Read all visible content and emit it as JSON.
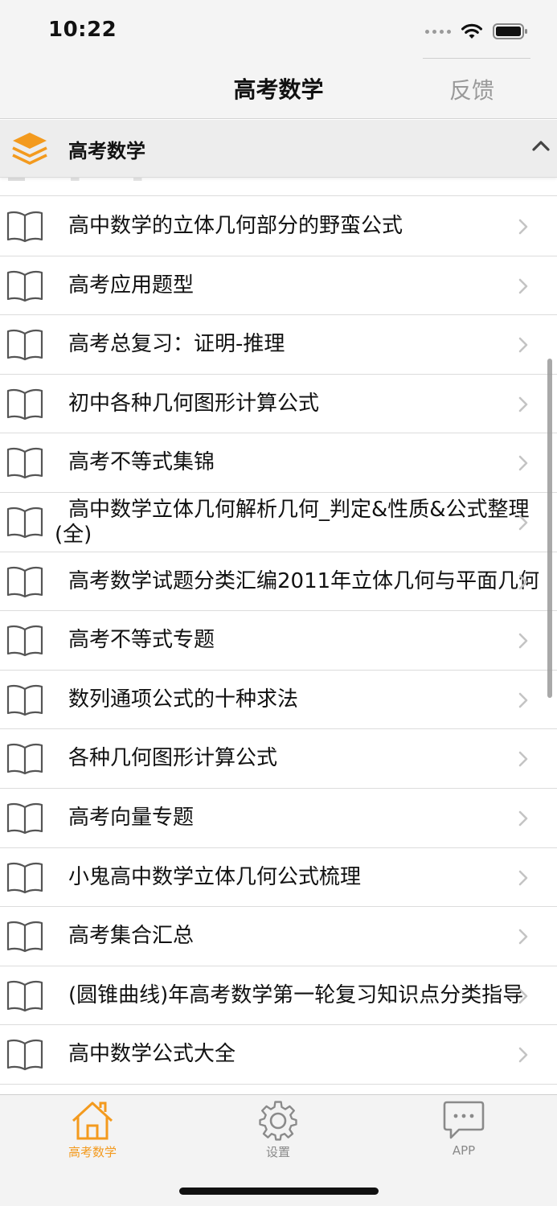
{
  "status_bar": {
    "time": "10:22"
  },
  "nav": {
    "title": "高考数学",
    "right_button": "反馈"
  },
  "section": {
    "title": "高考数学"
  },
  "list": {
    "items": [
      "高中数学的立体几何部分的野蛮公式",
      "高考应用题型",
      "高考总复习：证明-推理",
      "初中各种几何图形计算公式",
      "高考不等式集锦",
      "高中数学立体几何解析几何_判定&性质&公式整理(全)",
      "高考数学试题分类汇编2011年立体几何与平面几何",
      "高考不等式专题",
      "数列通项公式的十种求法",
      "各种几何图形计算公式",
      "高考向量专题",
      "小鬼高中数学立体几何公式梳理",
      "高考集合汇总",
      "(圆锥曲线)年高考数学第一轮复习知识点分类指导",
      "高中数学公式大全"
    ]
  },
  "tabbar": {
    "tabs": [
      {
        "label": "高考数学",
        "icon": "house-icon",
        "active": true
      },
      {
        "label": "设置",
        "icon": "gear-icon",
        "active": false
      },
      {
        "label": "APP",
        "icon": "chat-bubble-icon",
        "active": false
      }
    ]
  },
  "colors": {
    "accent": "#f39a1e",
    "separator": "#dcdcdc",
    "chevron": "#c4c4c4",
    "inactive": "#8a8a8a"
  }
}
